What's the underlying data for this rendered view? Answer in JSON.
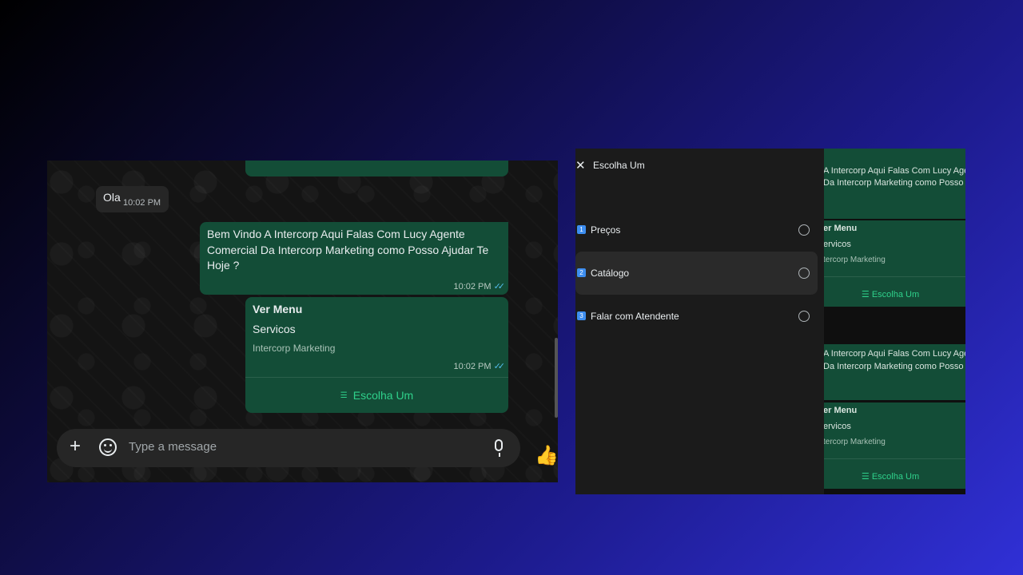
{
  "chat": {
    "incoming": {
      "text": "Ola",
      "time": "10:02 PM"
    },
    "outgoing_welcome": {
      "text": "Bem Vindo A Intercorp Aqui Falas Com Lucy Agente Comercial Da Intercorp Marketing como Posso Ajudar Te Hoje ?",
      "time": "10:02 PM"
    },
    "list_message": {
      "title": "Ver Menu",
      "body": "Servicos",
      "footer": "Intercorp Marketing",
      "time": "10:02 PM",
      "action_label": "Escolha Um"
    },
    "composer": {
      "placeholder": "Type a message"
    }
  },
  "list_panel": {
    "title": "Escolha Um",
    "options": [
      {
        "num": "1",
        "label": "Preços"
      },
      {
        "num": "2",
        "label": "Catálogo"
      },
      {
        "num": "3",
        "label": "Falar com Atendente"
      }
    ]
  },
  "background_chat": {
    "line1": "A Intercorp Aqui Falas Com Lucy Agente",
    "line2": "Da Intercorp Marketing como Posso Ajudar",
    "title_fragment": "er Menu",
    "body_fragment": "ervicos",
    "footer_fragment": "tercorp Marketing",
    "action": "Escolha Um"
  },
  "icons": {
    "plus": "plus-icon",
    "sticker": "sticker-icon",
    "mic": "microphone-icon",
    "thumb": "thumbs-up-icon",
    "close": "close-icon",
    "list": "list-icon",
    "ticks": "double-check-icon"
  },
  "colors": {
    "bubble_out": "#134d37",
    "accent": "#2fd18b",
    "tick": "#53bdeb"
  }
}
